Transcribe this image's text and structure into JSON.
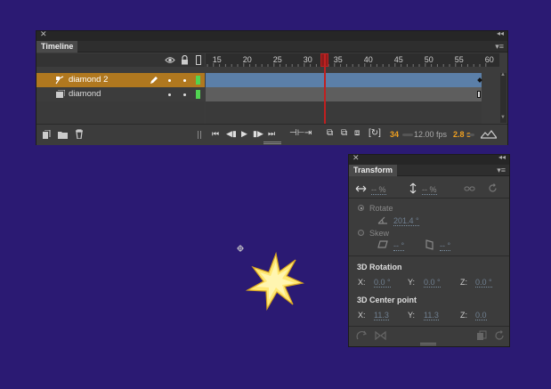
{
  "timeline": {
    "tab_label": "Timeline",
    "frame_numbers": [
      "15",
      "20",
      "25",
      "30",
      "35",
      "40",
      "45",
      "50",
      "55",
      "60"
    ],
    "layers": [
      {
        "name": "diamond 2",
        "selected": true
      },
      {
        "name": "diamond",
        "selected": false
      }
    ],
    "current_frame": "34",
    "fps": "12.00 fps",
    "elapsed": "2.8 s"
  },
  "transform": {
    "tab_label": "Transform",
    "width_value": "-- %",
    "height_value": "-- %",
    "rotate_label": "Rotate",
    "rotate_value": "201.4 °",
    "skew_label": "Skew",
    "skew_h": "-- °",
    "skew_v": "-- °",
    "rotation3d_title": "3D Rotation",
    "rot_x_label": "X:",
    "rot_x": "0.0 °",
    "rot_y_label": "Y:",
    "rot_y": "0.0 °",
    "rot_z_label": "Z:",
    "rot_z": "0.0 °",
    "center_title": "3D Center point",
    "cp_x_label": "X:",
    "cp_x": "11.3",
    "cp_y_label": "Y:",
    "cp_y": "11.3",
    "cp_z_label": "Z:",
    "cp_z": "0.0"
  },
  "colors": {
    "stage": "#2b1a73",
    "selected_layer": "#b0781f",
    "selected_frames": "#5b7fa8",
    "playhead": "#c02020",
    "accent_orange": "#f0a020",
    "star_fill": "#ffe873"
  }
}
